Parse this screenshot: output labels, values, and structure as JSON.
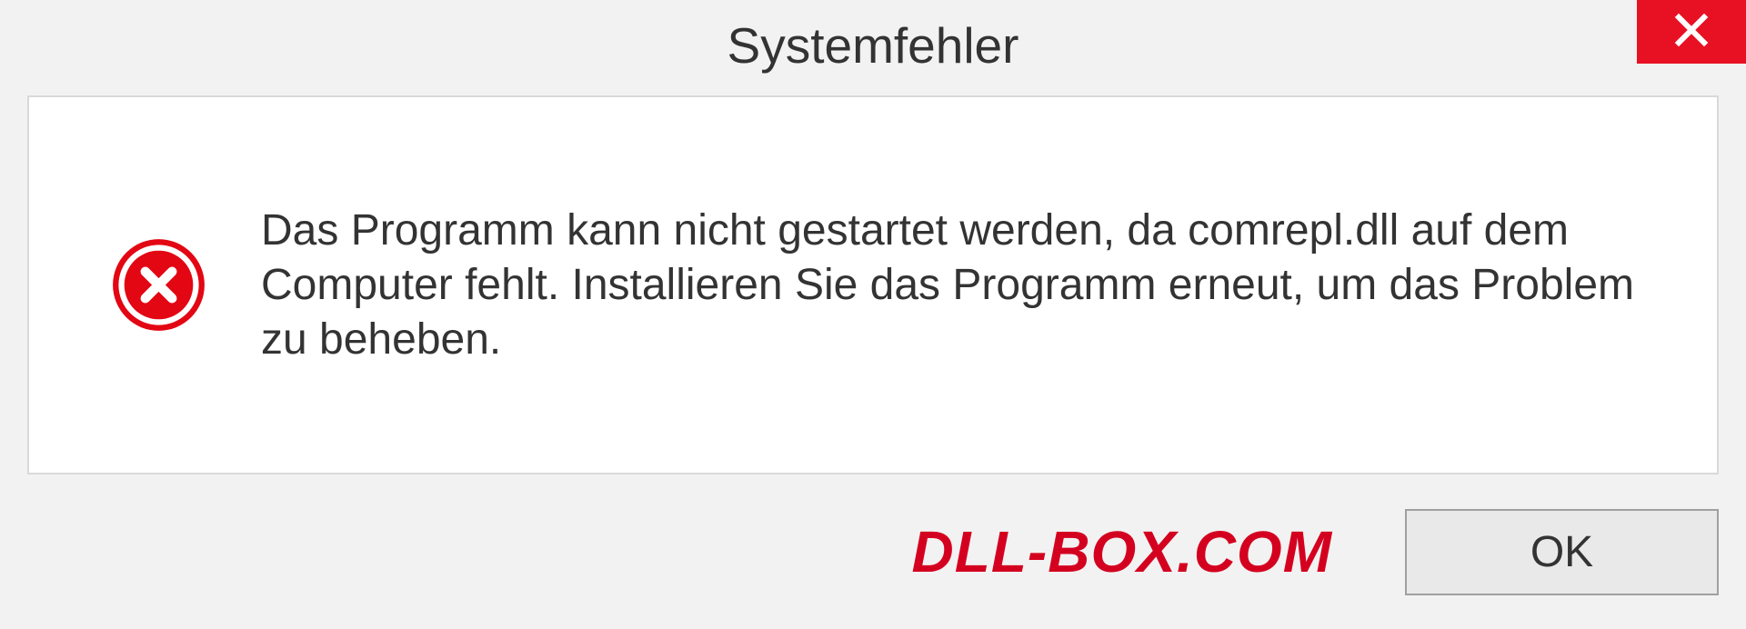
{
  "dialog": {
    "title": "Systemfehler",
    "message": "Das Programm kann nicht gestartet werden, da comrepl.dll auf dem Computer fehlt. Installieren Sie das Programm erneut, um das Problem zu beheben.",
    "ok_label": "OK"
  },
  "watermark": "DLL-BOX.COM"
}
